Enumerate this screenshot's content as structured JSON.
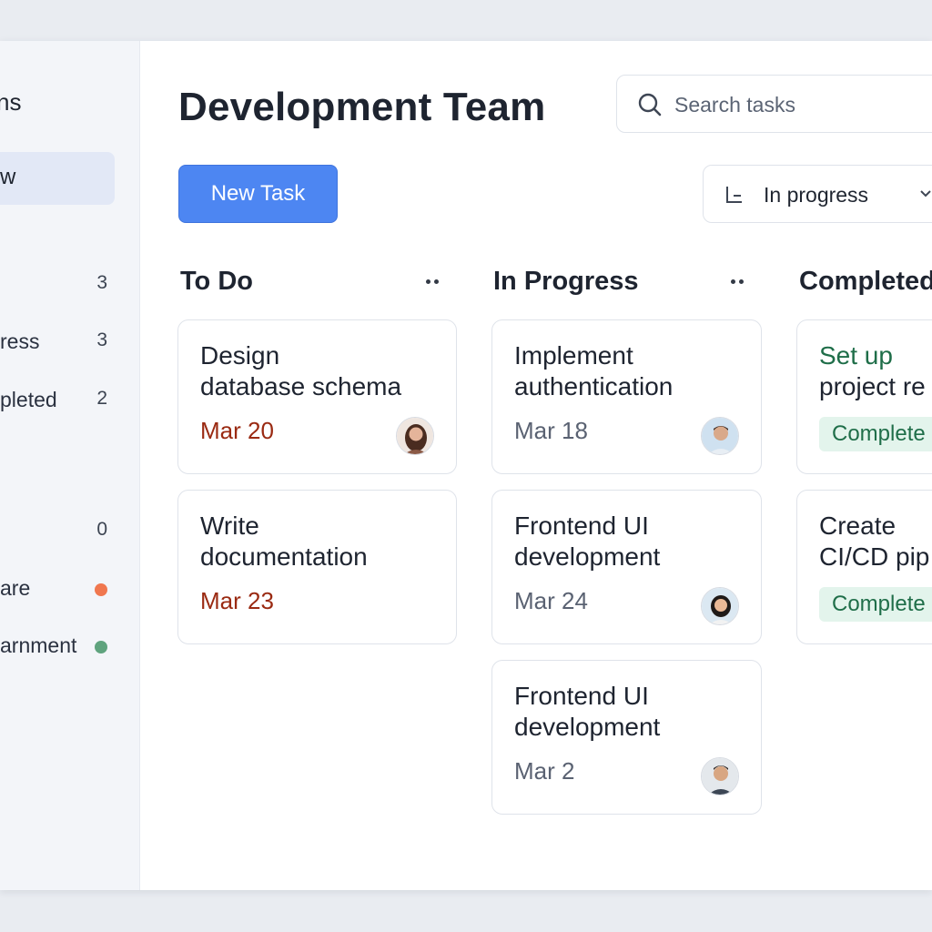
{
  "sidebar": {
    "title": "ns",
    "active_item": "w",
    "items": [
      {
        "label": "",
        "count": "3"
      },
      {
        "label": "ress",
        "count": "3"
      },
      {
        "label": "pleted",
        "count": "2"
      },
      {
        "label": "",
        "count": "0"
      },
      {
        "label": "are",
        "dot_color": "#f0774f"
      },
      {
        "label": "arnment",
        "dot_color": "#5fa37e"
      }
    ]
  },
  "header": {
    "title": "Development Team",
    "search_placeholder": "Search tasks",
    "new_task_label": "New Task",
    "filter_label": "In progress"
  },
  "columns": [
    {
      "title": "To Do",
      "cards": [
        {
          "title_line1": "Design",
          "title_line2": "database schema",
          "due": "Mar 20",
          "due_color": "#9a2a12",
          "assignee": "woman-avatar"
        },
        {
          "title_line1": "Write",
          "title_line2": "documentation",
          "due": "Mar 23",
          "due_color": "#9a2a12"
        }
      ]
    },
    {
      "title": "In Progress",
      "cards": [
        {
          "title_line1": "Implement",
          "title_line2": "authentication",
          "due": "Mar 18",
          "assignee": "man-avatar"
        },
        {
          "title_line1": "Frontend UI",
          "title_line2": "development",
          "due": "Mar 24",
          "assignee": "woman-avatar"
        },
        {
          "title_line1": "Frontend UI",
          "title_line2": "development",
          "due": "Mar 2",
          "assignee": "man-avatar"
        }
      ]
    },
    {
      "title": "Completed",
      "cards": [
        {
          "title_line1": "Set up",
          "title_line2": "project re",
          "badge": "Complete"
        },
        {
          "title_line1": "Create",
          "title_line2": "CI/CD  pip",
          "badge": "Complete"
        }
      ]
    }
  ],
  "colors": {
    "accent": "#4d86f2",
    "overdue": "#9a2a12",
    "complete_text": "#1f6e49",
    "complete_bg": "#e3f4ec"
  }
}
